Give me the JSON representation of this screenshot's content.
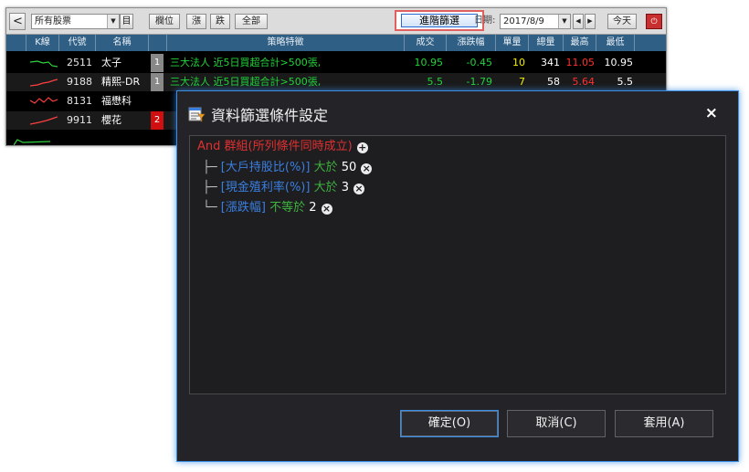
{
  "toolbar": {
    "back": "<",
    "group_select": "所有股票",
    "btn_c": "目",
    "btn_columns": "欄位",
    "btn_up": "漲",
    "btn_down": "跌",
    "btn_all": "全部",
    "advanced_filter": "進階篩選",
    "date_label": "日期:",
    "date_value": "2017/8/9",
    "today": "今天"
  },
  "table": {
    "headers": [
      "K線",
      "代號",
      "名稱",
      "策略特徵",
      "成交",
      "漲跌幅",
      "單量",
      "總量",
      "最高",
      "最低"
    ],
    "rows": [
      {
        "code": "2511",
        "name": "太子",
        "flag": "1",
        "strategy": "三大法人 近5日買超合計>500張,",
        "price": "10.95",
        "change": "-0.45",
        "unit_vol": "10",
        "total_vol": "341",
        "high": "11.05",
        "low": "10.95"
      },
      {
        "code": "9188",
        "name": "精熙-DR",
        "flag": "1",
        "strategy": "三大法人 近5日買超合計>500張,",
        "price": "5.5",
        "change": "-1.79",
        "unit_vol": "7",
        "total_vol": "58",
        "high": "5.64",
        "low": "5.5"
      },
      {
        "code": "8131",
        "name": "福懋科",
        "flag": "",
        "strategy": "",
        "price": "",
        "change": "",
        "unit_vol": "",
        "total_vol": "",
        "high": "",
        "low": ""
      },
      {
        "code": "9911",
        "name": "櫻花",
        "flag": "2",
        "strategy": "",
        "price": "",
        "change": "",
        "unit_vol": "",
        "total_vol": "",
        "high": "",
        "low": ""
      },
      {
        "code": "",
        "name": "",
        "flag": "",
        "strategy": "",
        "price": "",
        "change": "",
        "unit_vol": "",
        "total_vol": "",
        "high": "",
        "low": ""
      }
    ]
  },
  "dialog": {
    "title": "資料篩選條件設定",
    "close": "×",
    "group": {
      "prefix": "And 群組",
      "desc": "(所列條件同時成立)"
    },
    "conditions": [
      {
        "tree": "├─",
        "field": "[大戶持股比(%)]",
        "op": "大於",
        "value": "50"
      },
      {
        "tree": "├─",
        "field": "[現金殖利率(%)]",
        "op": "大於",
        "value": "3"
      },
      {
        "tree": "└─",
        "field": "[漲跌幅]",
        "op": "不等於",
        "value": "2"
      }
    ],
    "buttons": {
      "ok": "確定(O)",
      "cancel": "取消(C)",
      "apply": "套用(A)"
    }
  },
  "colors": {
    "dialog_bg": "#242428",
    "accent_blue": "#3b8ee8",
    "group_red": "#e03030",
    "field_blue": "#3a7fe0",
    "operator_green": "#3fb33f",
    "header_bar": "#2f5f84",
    "quote_green": "#22d33b"
  }
}
